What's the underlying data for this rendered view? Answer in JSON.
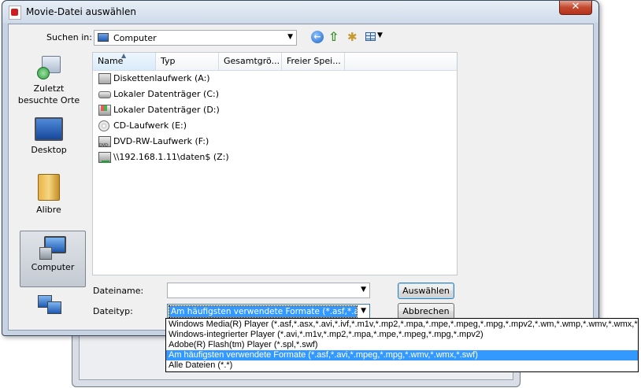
{
  "dialog": {
    "title": "Movie-Datei auswählen",
    "close_label": "✕"
  },
  "toolbar": {
    "look_in_label": "Suchen in:",
    "look_in_value": "Computer",
    "icons": [
      "back-icon",
      "up-folder-icon",
      "new-folder-icon",
      "views-menu-icon"
    ]
  },
  "places": [
    {
      "label_line1": "Zuletzt",
      "label_line2": "besuchte Orte",
      "icon": "recent-places-icon"
    },
    {
      "label_line1": "Desktop",
      "label_line2": "",
      "icon": "desktop-icon"
    },
    {
      "label_line1": "Alibre",
      "label_line2": "",
      "icon": "library-icon"
    },
    {
      "label_line1": "Computer",
      "label_line2": "",
      "icon": "computer-icon",
      "selected": true
    },
    {
      "label_line1": "",
      "label_line2": "",
      "icon": "network-icon"
    }
  ],
  "file_list": {
    "columns": [
      "Name",
      "Typ",
      "Gesamtgrö...",
      "Freier Spei..."
    ],
    "sorted_column": "Name",
    "rows": [
      {
        "name": "Diskettenlaufwerk (A:)",
        "icon": "floppy-drive-icon"
      },
      {
        "name": "Lokaler Datenträger (C:)",
        "icon": "hard-drive-icon"
      },
      {
        "name": "Lokaler Datenträger  (D:)",
        "icon": "windows-drive-icon"
      },
      {
        "name": "CD-Laufwerk (E:)",
        "icon": "cd-drive-icon"
      },
      {
        "name": "DVD-RW-Laufwerk (F:)",
        "icon": "dvd-drive-icon"
      },
      {
        "name": "\\\\192.168.1.11\\daten$ (Z:)",
        "icon": "network-drive-icon"
      }
    ]
  },
  "form": {
    "filename_label": "Dateiname:",
    "filename_value": "",
    "filetype_label": "Dateityp:",
    "filetype_value": "Am häufigsten verwendete Formate (*.asf,*.avi,*.m"
  },
  "buttons": {
    "select": "Auswählen",
    "cancel": "Abbrechen"
  },
  "filetype_options": [
    {
      "label": "Windows Media(R) Player (*.asf,*.asx,*.avi,*.ivf,*.m1v,*.mp2,*.mpa,*.mpe,*.mpeg,*.mpg,*.mpv2,*.wm,*.wmp,*.wmv,*.wmx,*.wvx)",
      "highlighted": false
    },
    {
      "label": "Windows-integrierter Player (*.avi,*.m1v,*.mp2,*.mpa,*.mpe,*.mpeg,*.mpg,*.mpv2)",
      "highlighted": false
    },
    {
      "label": "Adobe(R) Flash(tm) Player (*.spl,*.swf)",
      "highlighted": false
    },
    {
      "label": "Am häufigsten verwendete Formate (*.asf,*.avi,*.mpeg,*.mpg,*.wmv,*.wmx,*.swf)",
      "highlighted": true
    },
    {
      "label": "Alle Dateien (*.*)",
      "highlighted": false
    }
  ],
  "colors": {
    "selection": "#3399ff",
    "dialog_frame": "#c7d3e2",
    "close_button": "#c24a2e"
  }
}
